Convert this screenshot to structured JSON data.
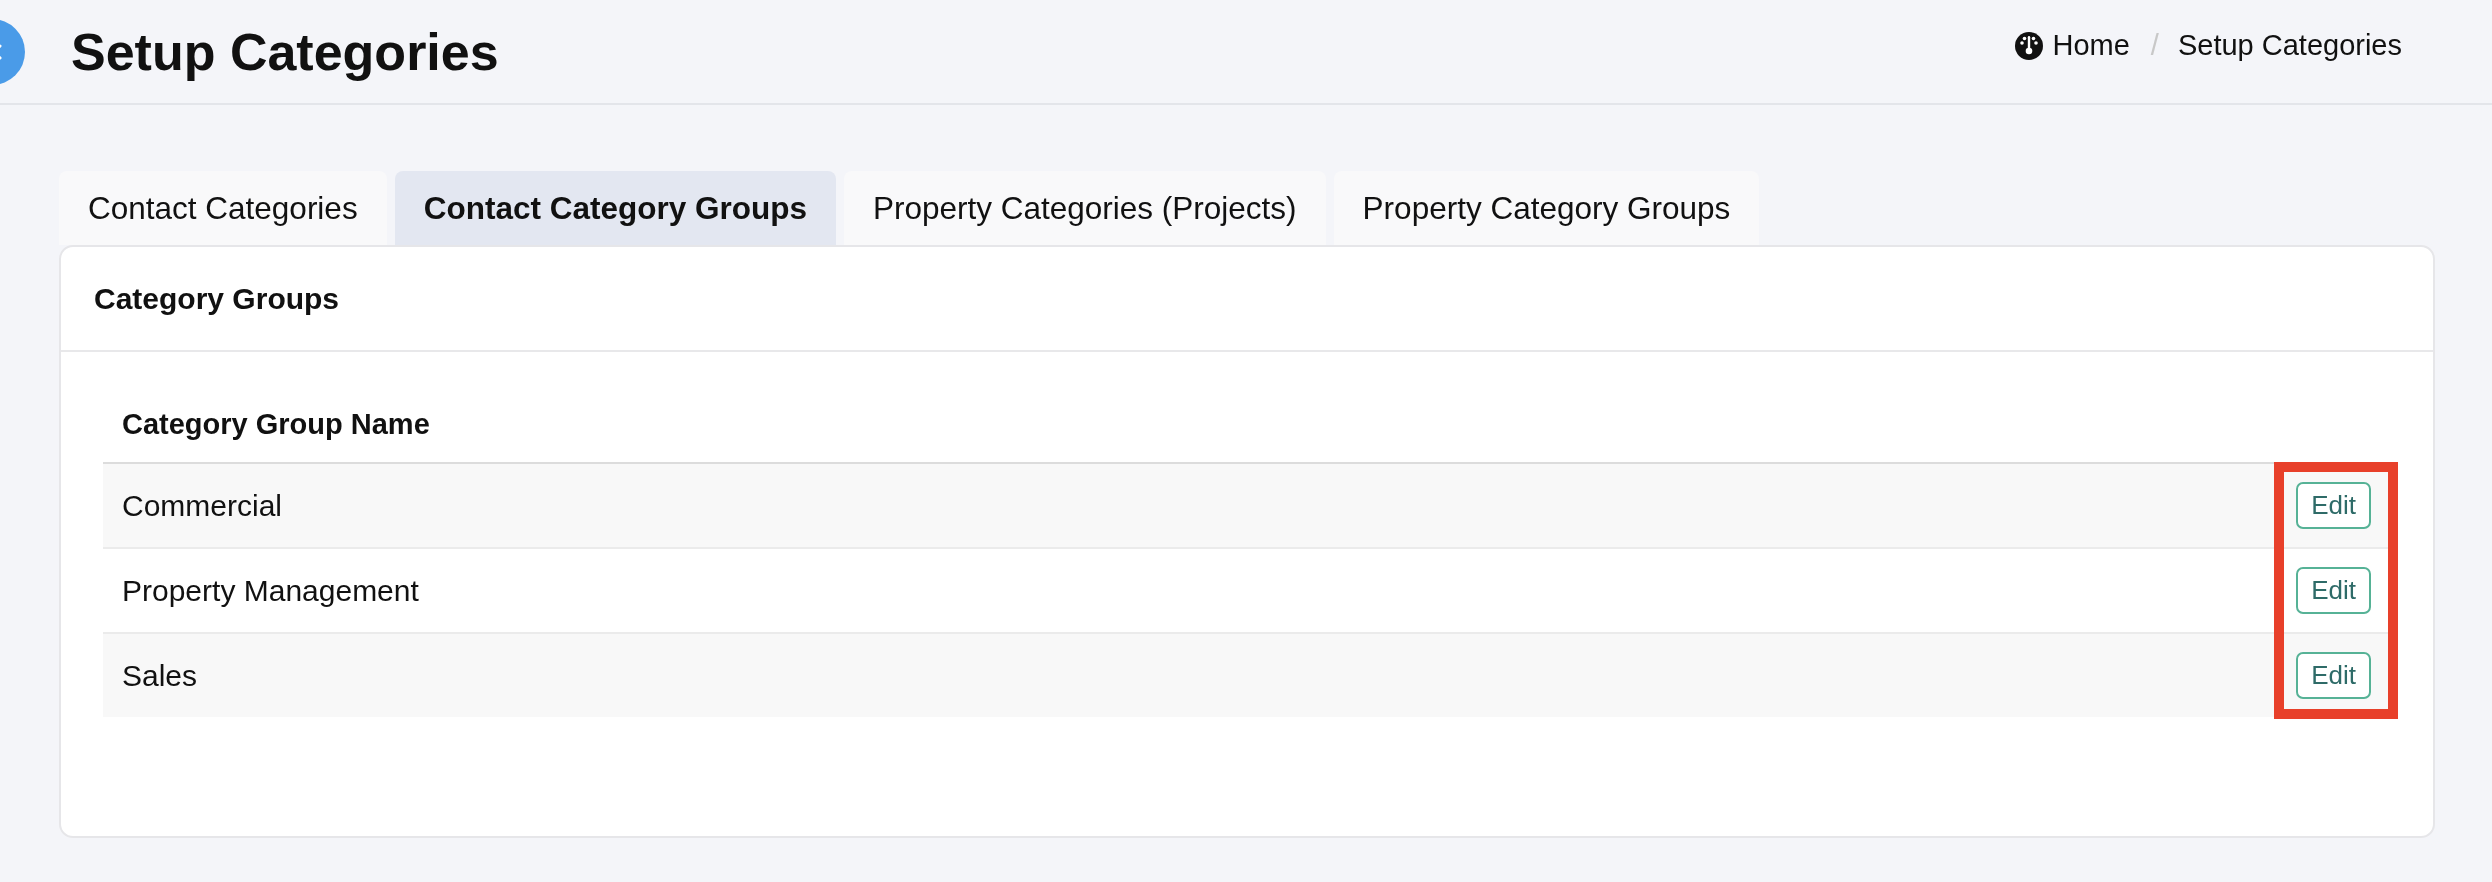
{
  "header": {
    "title": "Setup Categories",
    "breadcrumb": {
      "items": [
        {
          "label": "Home",
          "kind": "home"
        },
        {
          "label": "Setup Categories",
          "kind": "current"
        }
      ],
      "separator": "/"
    }
  },
  "tabs": [
    {
      "label": "Contact Categories",
      "selected": false
    },
    {
      "label": "Contact Category Groups",
      "selected": true
    },
    {
      "label": "Property Categories (Projects)",
      "selected": false
    },
    {
      "label": "Property Category Groups",
      "selected": false
    }
  ],
  "card": {
    "title": "Category Groups",
    "table": {
      "columns": [
        "Category Group Name"
      ],
      "rows": [
        {
          "name": "Commercial",
          "action": "Edit"
        },
        {
          "name": "Property Management",
          "action": "Edit"
        },
        {
          "name": "Sales",
          "action": "Edit"
        }
      ],
      "actions_highlighted": true
    }
  }
}
